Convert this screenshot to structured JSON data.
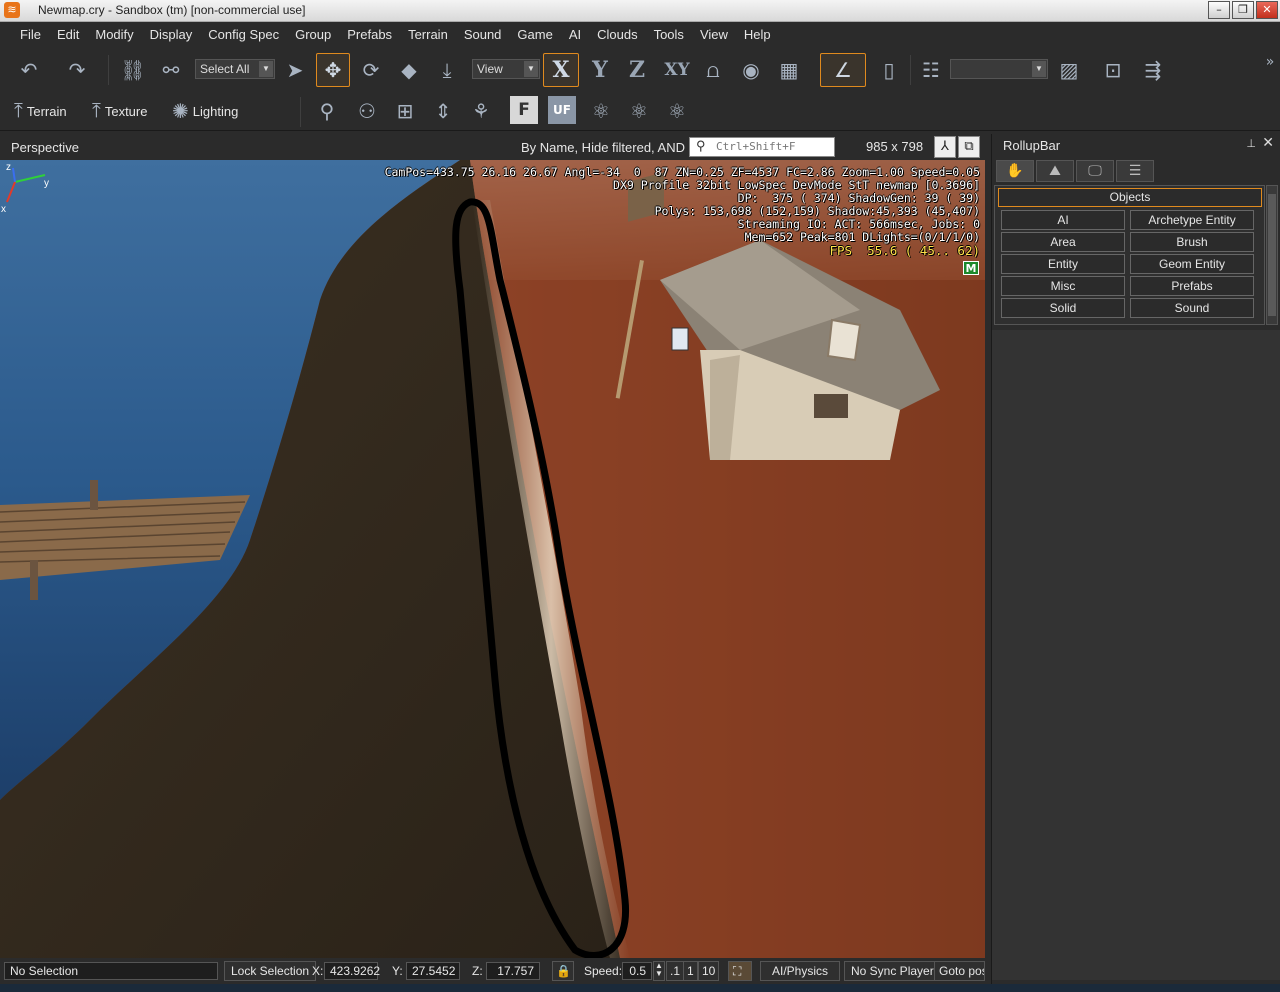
{
  "window": {
    "title": "Newmap.cry - Sandbox (tm) [non-commercial use]",
    "logo_glyph": "≋",
    "buttons": {
      "minimize": "–",
      "maximize": "❐",
      "close": "✕"
    }
  },
  "menubar": {
    "items": [
      "File",
      "Edit",
      "Modify",
      "Display",
      "Config Spec",
      "Group",
      "Prefabs",
      "Terrain",
      "Sound",
      "Game",
      "AI",
      "Clouds",
      "Tools",
      "View",
      "Help"
    ]
  },
  "toolbar1": {
    "select_combo": "Select All",
    "view_combo": "View",
    "axis_x": "X",
    "axis_y": "Y",
    "axis_z": "Z",
    "axis_xy": "XY",
    "layer_combo": "",
    "overflow": "»"
  },
  "toolbar2": {
    "terrain": "Terrain",
    "texture": "Texture",
    "lighting": "Lighting",
    "f_button": "F",
    "uf_button": "UF"
  },
  "viewport": {
    "title": "Perspective",
    "filter_text": "By Name, Hide filtered, AND",
    "search_placeholder": "Ctrl+Shift+F",
    "resolution": "985 x 798",
    "hud": {
      "line1": "CamPos=433.75 26.16 26.67 Angl=-34  0  87 ZN=0.25 ZF=4537 FC=2.86 Zoom=1.00 Speed=0.05",
      "line2": "DX9 Profile 32bit LowSpec DevMode StT newmap [0.3696]",
      "line3": "DP:  375 ( 374) ShadowGen: 39 ( 39)",
      "line4": "Polys: 153,698 (152,159) Shadow:45,393 (45,407)",
      "line5": "Streaming IO: ACT: 566msec, Jobs: 0",
      "line6": "Mem=652 Peak=801 DLights=(0/1/1/0)",
      "fps": "FPS  55.6 ( 45.. 62)",
      "m_badge": "M"
    },
    "axes": {
      "x": "x",
      "y": "y",
      "z": "z"
    }
  },
  "statusbar": {
    "selection": "No Selection",
    "lock_selection": "Lock Selection",
    "x_label": "X:",
    "x_value": "423.9262",
    "y_label": "Y:",
    "y_value": "27.5452",
    "z_label": "Z:",
    "z_value": "17.757",
    "speed_label": "Speed:",
    "speed_value": "0.5",
    "speed_01": ".1",
    "speed_1": "1",
    "speed_10": "10",
    "ai_physics": "AI/Physics",
    "sync_player": "No Sync Player",
    "goto_pos": "Goto pos"
  },
  "rollup": {
    "title": "RollupBar",
    "pin": "⊥",
    "close": "✕",
    "section": "Objects",
    "buttons": [
      "AI",
      "Archetype Entity",
      "Area",
      "Brush",
      "Entity",
      "Geom Entity",
      "Misc",
      "Prefabs",
      "Solid",
      "Sound"
    ]
  },
  "colors": {
    "accent": "#e08a1e",
    "panel_bg": "#2b2b2b",
    "hud_fps": "#ffe14a"
  }
}
